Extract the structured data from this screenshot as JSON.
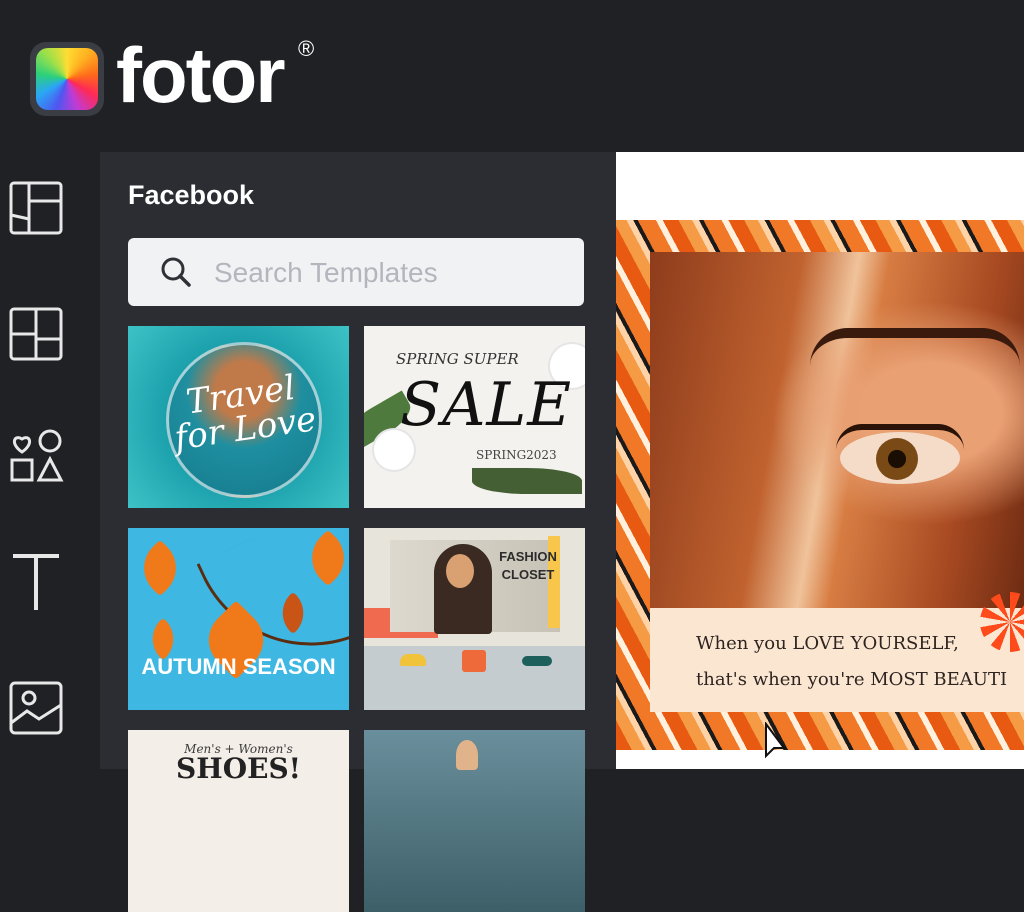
{
  "app": {
    "brand": "fotor",
    "registered": "®"
  },
  "rail": {
    "items": [
      {
        "icon": "templates-icon"
      },
      {
        "icon": "layout-icon"
      },
      {
        "icon": "elements-icon"
      },
      {
        "icon": "text-icon"
      },
      {
        "icon": "photos-icon"
      }
    ]
  },
  "panel": {
    "title": "Facebook",
    "search": {
      "placeholder": "Search Templates",
      "value": ""
    },
    "templates": [
      {
        "lines": [
          "Travel",
          "for Love"
        ]
      },
      {
        "top": "SPRING SUPER",
        "big": "SALE",
        "date": "SPRING2023"
      },
      {
        "title": "AUTUMN SEASON"
      },
      {
        "heading": [
          "FASHION",
          "CLOSET"
        ]
      },
      {
        "small": "Men's + Women's",
        "big": "SHOES!"
      },
      {}
    ]
  },
  "canvas": {
    "quote_line1": "When you LOVE YOURSELF,",
    "quote_line2": "that's when you're MOST BEAUTI"
  },
  "colors": {
    "bg": "#1f2125",
    "panel": "#2b2d33",
    "accent": "#f07826"
  }
}
